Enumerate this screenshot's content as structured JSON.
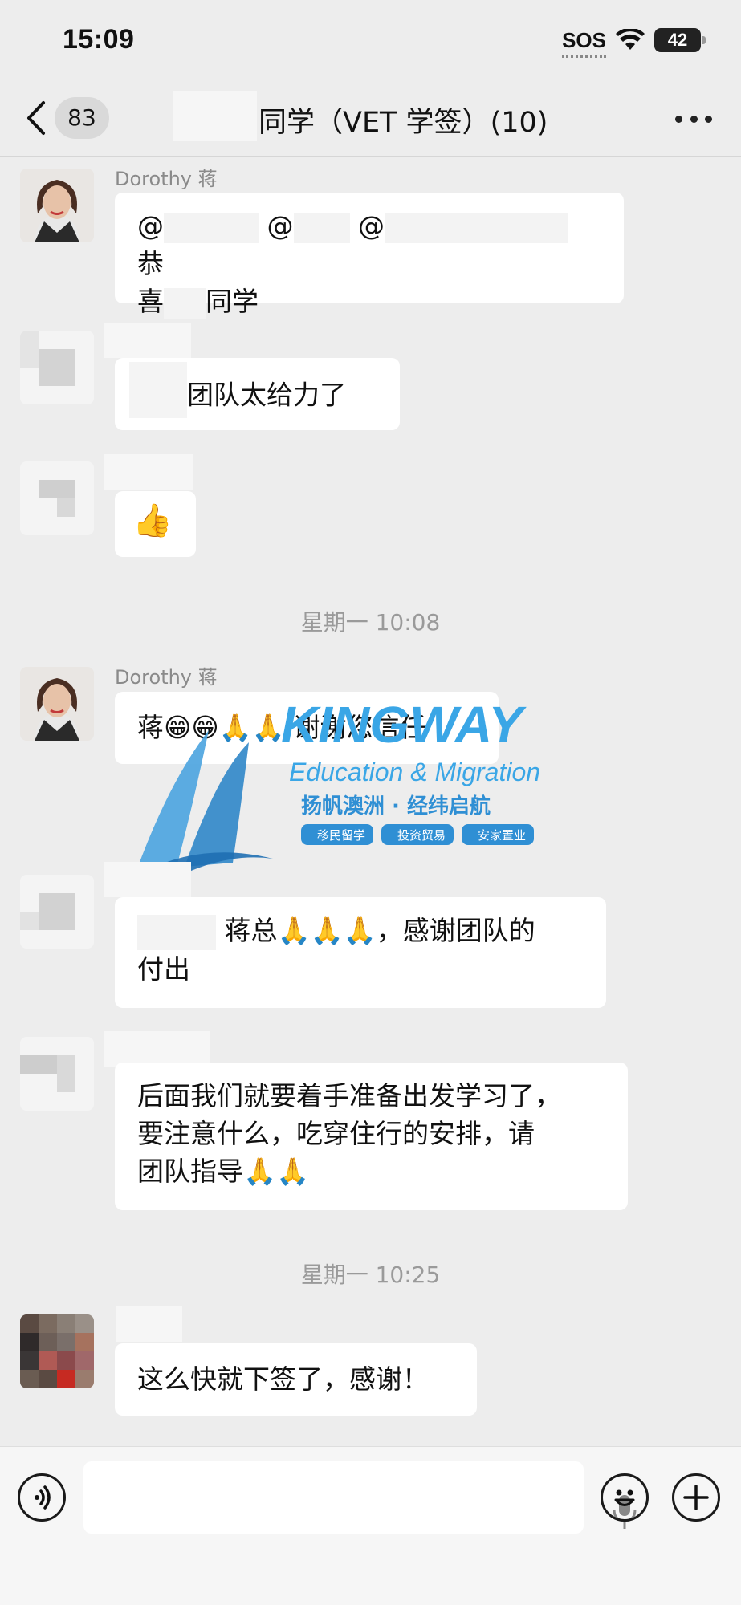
{
  "status": {
    "time": "15:09",
    "sos": "SOS",
    "battery": "42"
  },
  "nav": {
    "unread_count": "83",
    "title": "同学（VET 学签）(10)"
  },
  "messages": [
    {
      "sender": "Dorothy 蒋",
      "parts": [
        "@",
        "@",
        "@",
        "恭",
        "喜",
        "同学"
      ]
    },
    {
      "text": "团队太给力了"
    },
    {
      "text": "👍"
    },
    {
      "text": "蒋😁😁🙏🙏 谢谢您信任"
    },
    {
      "text_a": "蒋总🙏🙏🙏，感谢团队的",
      "text_b": "付出"
    },
    {
      "lines": [
        "后面我们就要着手准备出发学习了，",
        "要注意什么，吃穿住行的安排，请",
        "团队指导🙏🙏"
      ]
    },
    {
      "text": "这么快就下签了，感谢！"
    }
  ],
  "timestamps": [
    "星期一 10:08",
    "星期一 10:25"
  ],
  "watermark": {
    "brand": "KINGWAY",
    "tagline": "Education & Migration",
    "slogan": "扬帆澳洲 · 经纬启航",
    "tags": [
      "移民留学",
      "投资贸易",
      "安家置业"
    ]
  },
  "icons": [
    "back-icon",
    "more-icon",
    "voice-icon",
    "mic-icon",
    "emoji-icon",
    "plus-icon",
    "wifi-icon",
    "battery-icon"
  ]
}
